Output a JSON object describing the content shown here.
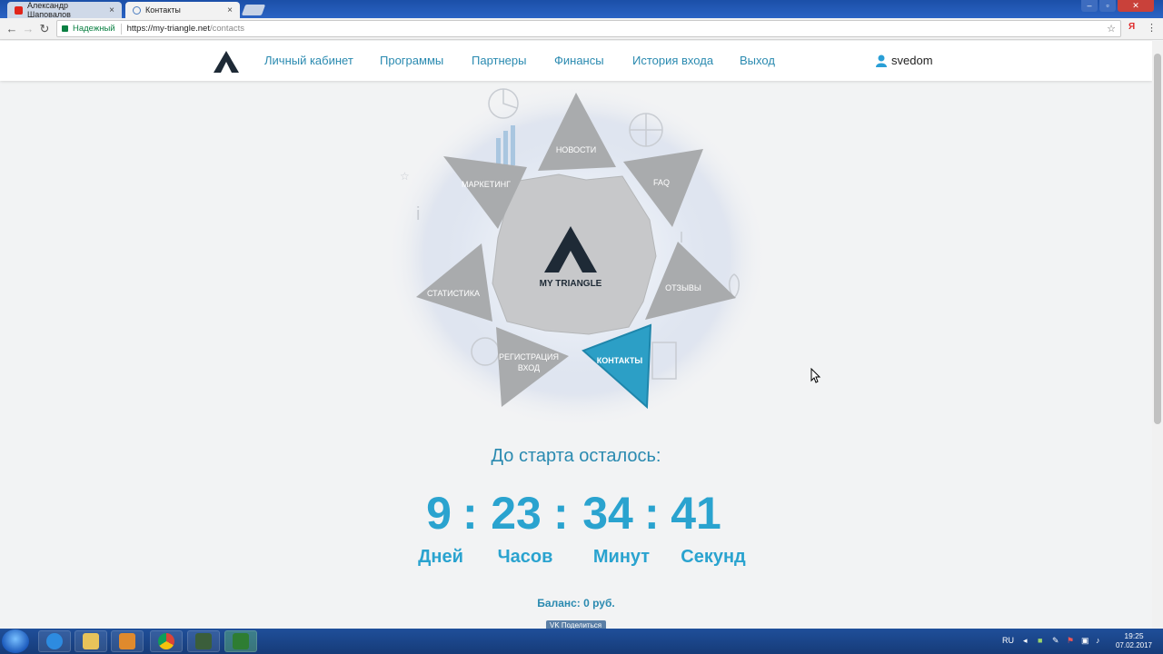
{
  "browser": {
    "tabs": [
      {
        "title": "Александр Шаповалов"
      },
      {
        "title": "Контакты"
      }
    ],
    "address": {
      "secure_label": "Надежный",
      "url_host": "https://my-triangle.net",
      "url_path": "/contacts"
    }
  },
  "site": {
    "nav": [
      {
        "label": "Личный кабинет"
      },
      {
        "label": "Программы"
      },
      {
        "label": "Партнеры"
      },
      {
        "label": "Финансы"
      },
      {
        "label": "История входа"
      },
      {
        "label": "Выход"
      }
    ],
    "username": "svedom"
  },
  "hero": {
    "brand": "MY TRIANGLE",
    "wedges": {
      "news": "НОВОСТИ",
      "faq": "FAQ",
      "marketing": "МАРКЕТИНГ",
      "stats": "СТАТИСТИКА",
      "reviews": "ОТЗЫВЫ",
      "reg_line1": "РЕГИСТРАЦИЯ",
      "reg_line2": "ВХОД",
      "contacts": "КОНТАКТЫ"
    }
  },
  "countdown": {
    "title": "До старта осталось:",
    "days": "9",
    "hours": "23",
    "minutes": "34",
    "seconds": "41",
    "separator": ":",
    "days_label": "Дней",
    "hours_label": "Часов",
    "minutes_label": "Минут",
    "seconds_label": "Секунд"
  },
  "balance": "Баланс: 0 руб.",
  "share_label": "Поделиться",
  "taskbar": {
    "lang": "RU",
    "time": "19:25",
    "date": "07.02.2017"
  },
  "colors": {
    "accent": "#2aa3cf",
    "link": "#2a8ab0",
    "active_wedge": "#2c9fc6",
    "wedge": "#a9abad"
  }
}
